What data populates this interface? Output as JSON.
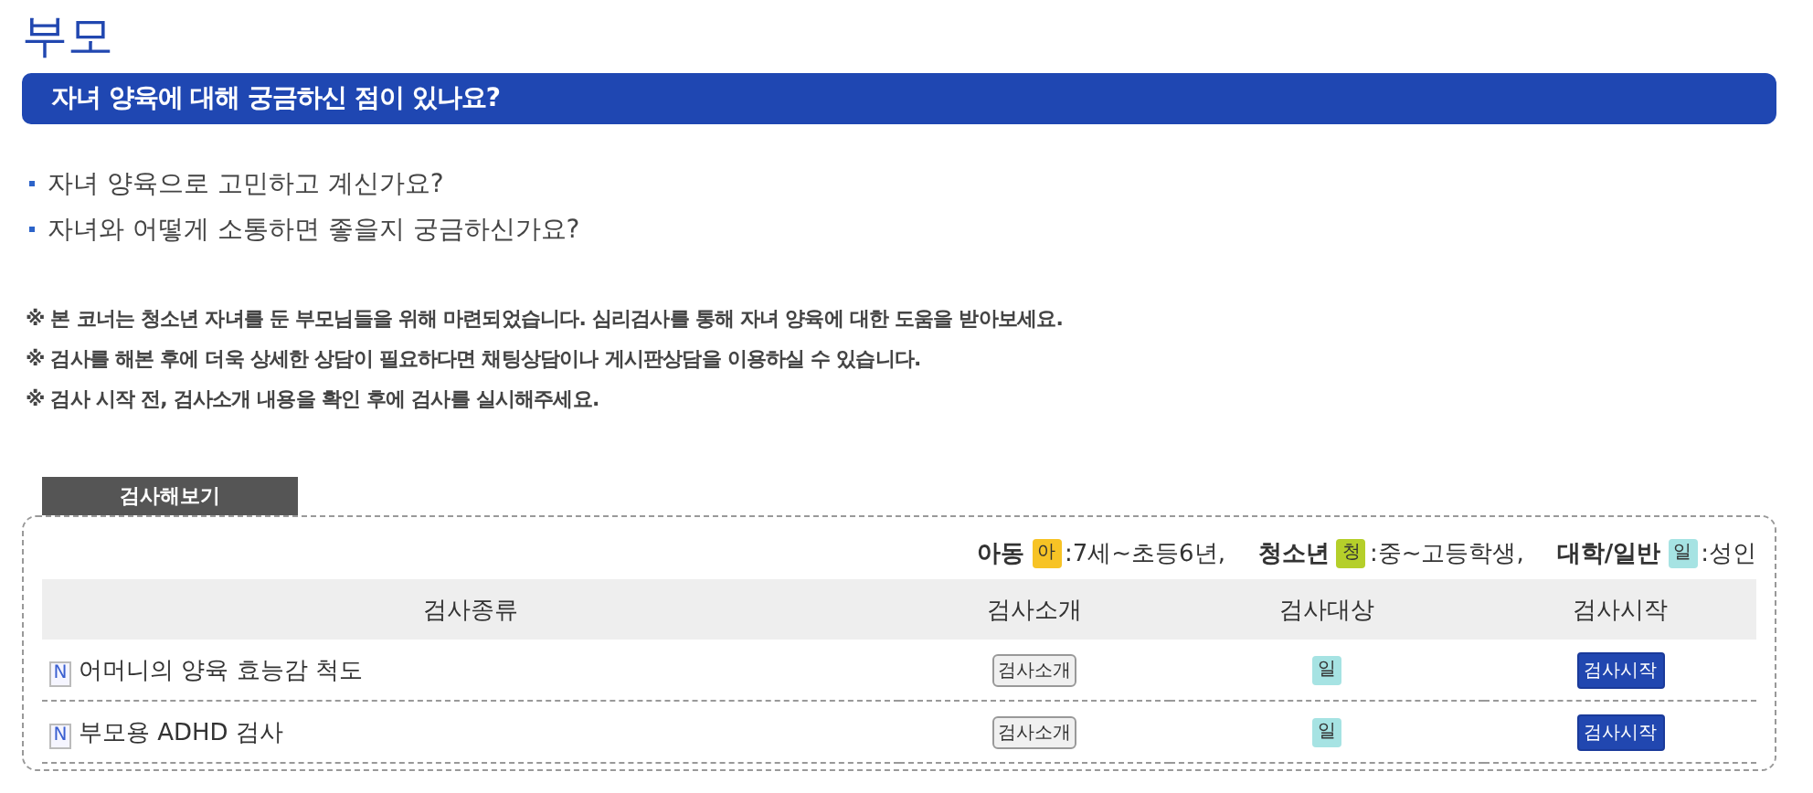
{
  "page_title": "부모",
  "banner": "자녀 양육에 대해 궁금하신 점이 있나요?",
  "questions": [
    "자녀 양육으로 고민하고 계신가요?",
    "자녀와 어떻게 소통하면 좋을지 궁금하신가요?"
  ],
  "notes": [
    "※ 본 코너는 청소년 자녀를 둔 부모님들을 위해 마련되었습니다. 심리검사를 통해 자녀 양육에 대한 도움을 받아보세요.",
    "※ 검사를 해본 후에 더욱 상세한 상담이 필요하다면 채팅상담이나 게시판상담을 이용하실 수 있습니다.",
    "※ 검사 시작 전, 검사소개 내용을 확인 후에 검사를 실시해주세요."
  ],
  "section_tab": "검사해보기",
  "legend": [
    {
      "label": "아동",
      "badge": "아",
      "color": "#f7c325",
      "description": ":7세~초등6년,"
    },
    {
      "label": "청소년",
      "badge": "청",
      "color": "#b5cf2a",
      "description": ":중~고등학생,"
    },
    {
      "label": "대학/일반",
      "badge": "일",
      "color": "#a6e3e3",
      "description": ":성인"
    }
  ],
  "table": {
    "columns": [
      "검사종류",
      "검사소개",
      "검사대상",
      "검사시작"
    ],
    "rows": [
      {
        "new_badge": "N",
        "name": "어머니의 양육 효능감 척도",
        "intro_button": "검사소개",
        "target": {
          "label": "일",
          "color": "#a6e3e3"
        },
        "start_button": "검사시작"
      },
      {
        "new_badge": "N",
        "name": "부모용 ADHD 검사",
        "intro_button": "검사소개",
        "target": {
          "label": "일",
          "color": "#a6e3e3"
        },
        "start_button": "검사시작"
      }
    ]
  }
}
